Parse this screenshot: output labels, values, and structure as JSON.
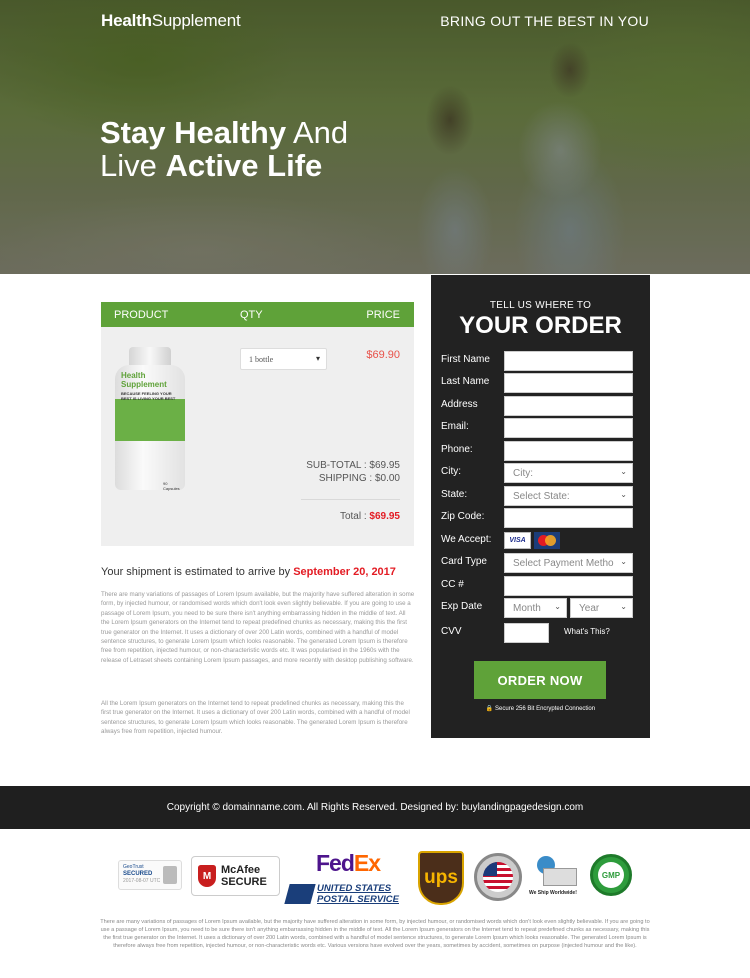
{
  "header": {
    "logo_bold": "Health",
    "logo_light": "Supplement",
    "tagline": "BRING OUT THE BEST IN YOU"
  },
  "hero": {
    "line1_bold": "Stay Healthy",
    "line1_light": " And",
    "line2_light": "Live ",
    "line2_bold": "Active Life"
  },
  "cart": {
    "columns": [
      "PRODUCT",
      "QTY",
      "PRICE"
    ],
    "product": {
      "name_line1": "Health",
      "name_line2": "Supplement",
      "tagline": "BECAUSE FEELING YOUR BEST IS LIVING YOUR BEST",
      "count": "90 Capsules"
    },
    "qty_selected": "1 bottle",
    "price": "$69.90",
    "subtotal_label": "SUB-TOTAL : ",
    "subtotal": "$69.95",
    "shipping_label": "SHIPPING : ",
    "shipping": "$0.00",
    "total_label": "Total : ",
    "total": "$69.95"
  },
  "shipment": {
    "text": "Your shipment is estimated to arrive by ",
    "date": "September 20, 2017"
  },
  "body_text": [
    "There are many variations of passages of Lorem Ipsum available, but the majority have suffered alteration in some form, by injected humour, or randomised words which don't look even slightly believable. If you are going to use a passage of Lorem Ipsum, you need to be sure there isn't anything embarrassing hidden in the middle of text. All the Lorem Ipsum generators on the Internet tend to repeat predefined chunks as necessary, making this the first true generator on the Internet. It uses a dictionary of over 200 Latin words, combined with a handful of model sentence structures, to generate Lorem Ipsum which looks reasonable. The generated Lorem Ipsum is therefore free from repetition, injected humour, or non-characteristic words etc. It was popularised in the 1960s with the release of Letraset sheets containing Lorem Ipsum passages, and more recently with desktop publishing software.",
    "All the Lorem Ipsum generators on the Internet tend to repeat predefined chunks as necessary, making this the first true generator on the Internet. It uses a dictionary of over 200 Latin words, combined with a handful of model sentence structures, to generate Lorem Ipsum which looks reasonable. The generated Lorem Ipsum is therefore always free from repetition, injected humour."
  ],
  "form": {
    "subtitle": "TELL US WHERE TO",
    "title": "YOUR ORDER",
    "labels": {
      "first_name": "First Name",
      "last_name": "Last Name",
      "address": "Address",
      "email": "Email:",
      "phone": "Phone:",
      "city": "City:",
      "state": "State:",
      "zip": "Zip Code:",
      "accept": "We Accept:",
      "card_type": "Card Type",
      "cc": "CC #",
      "exp": "Exp Date",
      "cvv": "CVV"
    },
    "city_placeholder": "City:",
    "state_placeholder": "Select State:",
    "card_type_placeholder": "Select Payment Metho",
    "month_placeholder": "Month",
    "year_placeholder": "Year",
    "cards": [
      "VISA",
      "MasterCard"
    ],
    "whats_this": "What's This?",
    "order_button": "ORDER NOW",
    "secure_text": "Secure 256 Bit Encrypted Connection"
  },
  "footer": {
    "copyright": "Copyright © domainname.com. All Rights Reserved. Designed by: buylandingpagedesign.com"
  },
  "badges": {
    "geotrust": {
      "brand": "GeoTrust",
      "label": "SECURED",
      "date": "2017-08-07 UTC"
    },
    "mcafee": {
      "line1": "McAfee",
      "line2": "SECURE"
    },
    "fedex": {
      "fe": "Fed",
      "ex": "Ex"
    },
    "usps": {
      "line1": "UNITED STATES",
      "line2": "POSTAL SERVICE"
    },
    "ups": "ups",
    "usa": "MADE IN THE USA",
    "ship": "We Ship Worldwide!",
    "gmp": "GMP"
  },
  "bottom_text": "There are many variations of passages of Lorem Ipsum available, but the majority have suffered alteration in some form, by injected humour, or randomised words which don't look even slightly believable. If you are going to use a passage of Lorem Ipsum, you need to be sure there isn't anything embarrassing hidden in the middle of text. All the Lorem Ipsum generators on the Internet tend to repeat predefined chunks as necessary, making this the first true generator on the Internet. It uses a dictionary of over 200 Latin words, combined with a handful of model sentence structures, to generate Lorem Ipsum which looks reasonable. The generated Lorem Ipsum is therefore always free from repetition, injected humour, or non-characteristic words etc. Various versions have evolved over the years, sometimes by accident, sometimes on purpose (injected humour and the like)."
}
